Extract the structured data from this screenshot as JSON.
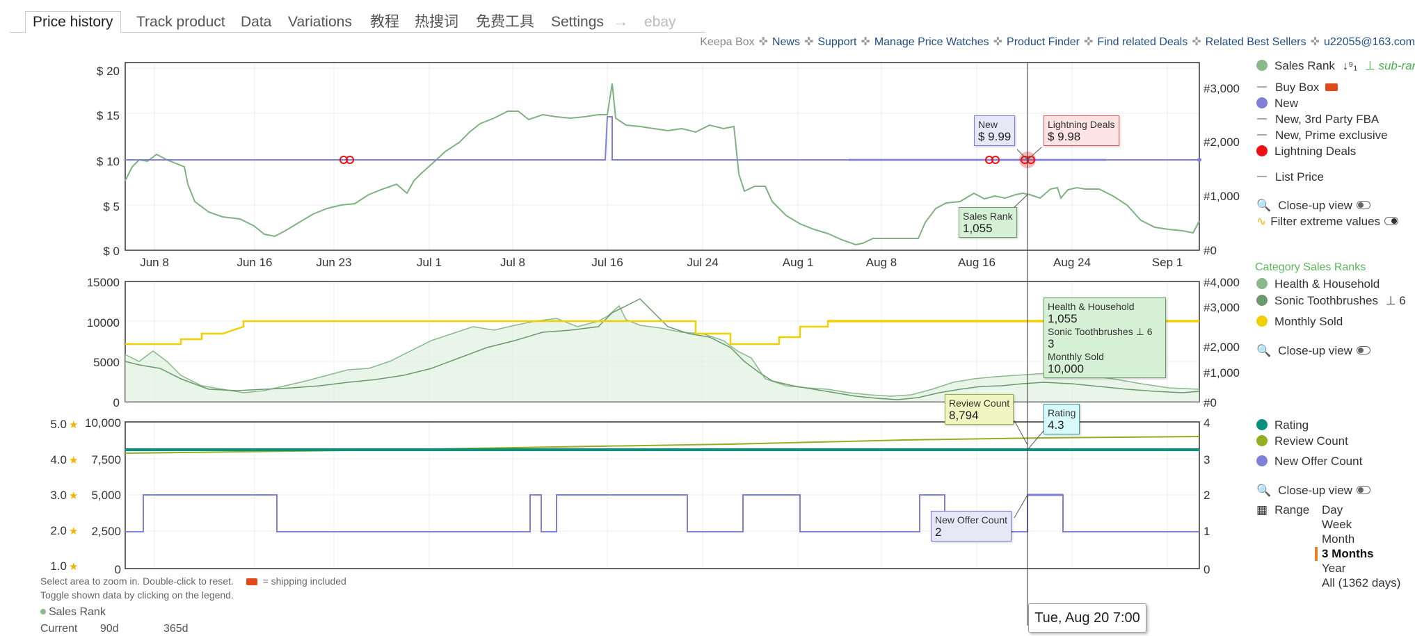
{
  "tabs": [
    {
      "label": "Price history",
      "active": true
    },
    {
      "label": "Track product"
    },
    {
      "label": "Data"
    },
    {
      "label": "Variations"
    },
    {
      "label": "教程"
    },
    {
      "label": "热搜词"
    },
    {
      "label": "免费工具"
    },
    {
      "label": "Settings"
    },
    {
      "label": "→"
    },
    {
      "label": "ebay"
    }
  ],
  "toplinks": {
    "keepa_box": "Keepa Box",
    "separator": "✜",
    "news": "News",
    "support": "Support",
    "manage": "Manage Price Watches",
    "finder": "Product Finder",
    "deals": "Find related Deals",
    "bestsellers": "Related Best Sellers",
    "user": "u22055@163.com"
  },
  "colors": {
    "sales_rank": "#8ab98a",
    "new": "#8080d8",
    "lightning": "#ee1111",
    "monthly_sold": "#f0d000",
    "rating": "#0a9080",
    "review": "#90b020",
    "offer": "#8080d8",
    "range_marker": "#e67e22"
  },
  "chart1": {
    "left_ticks": [
      "$ 20",
      "$ 15",
      "$ 10",
      "$ 5",
      "$ 0"
    ],
    "right_ticks": [
      "#3,000",
      "#2,000",
      "#1,000",
      "#0"
    ],
    "x_labels": [
      "Jun 8",
      "Jun 16",
      "Jun 23",
      "Jul 1",
      "Jul 8",
      "Jul 16",
      "Jul 24",
      "Aug 1",
      "Aug 8",
      "Aug 16",
      "Aug 24",
      "Sep 1"
    ],
    "tips": {
      "new_label": "New",
      "new_value": "$ 9.99",
      "lightning_label": "Lightning Deals",
      "lightning_value": "$ 9.98",
      "rank_label": "Sales Rank",
      "rank_value": "1,055"
    }
  },
  "chart2": {
    "left_ticks": [
      "15000",
      "10000",
      "5000",
      "0"
    ],
    "right_ticks": [
      "#4,000",
      "#3,000",
      "#2,000",
      "#1,000",
      "#0"
    ],
    "tip": {
      "cat1": "Health & Household",
      "cat1_value": "1,055",
      "cat2": "Sonic Toothbrushes",
      "cat2_value": "3",
      "cat2_count": "6",
      "sold_label": "Monthly Sold",
      "sold_value": "10,000"
    }
  },
  "chart3": {
    "rating_ticks": [
      "5.0",
      "4.0",
      "3.0",
      "2.0",
      "1.0"
    ],
    "review_ticks": [
      "10,000",
      "7,500",
      "5,000",
      "2,500",
      "0"
    ],
    "right_ticks": [
      "4",
      "3",
      "2",
      "1",
      "0"
    ],
    "tips": {
      "review_label": "Review Count",
      "review_value": "8,794",
      "rating_label": "Rating",
      "rating_value": "4.3",
      "offer_label": "New Offer Count",
      "offer_value": "2"
    }
  },
  "legend": {
    "sales_rank": "Sales Rank",
    "sub_ranks": "sub-ranks",
    "buy_box": "Buy Box",
    "new": "New",
    "new_3p": "New, 3rd Party FBA",
    "new_prime": "New, Prime exclusive",
    "lightning": "Lightning Deals",
    "list_price": "List Price",
    "closeup": "Close-up view",
    "filter": "Filter extreme values",
    "category_title": "Category Sales Ranks",
    "health": "Health & Household",
    "sonic": "Sonic Toothbrushes",
    "sonic_count": "6",
    "monthly_sold": "Monthly Sold",
    "rating": "Rating",
    "review_count": "Review Count",
    "offer_count": "New Offer Count",
    "range_label": "Range",
    "range_options": [
      "Day",
      "Week",
      "Month",
      "3 Months",
      "Year",
      "All (1362 days)"
    ],
    "range_selected": "3 Months"
  },
  "hints": {
    "line1": "Select area to zoom in. Double-click to reset.",
    "shipping": "= shipping included",
    "line2": "Toggle shown data by clicking on the legend."
  },
  "footer": {
    "rank_title": "Sales Rank",
    "current": "Current",
    "d90": "90d",
    "d365": "365d"
  },
  "hover_date": "Tue, Aug 20 7:00"
}
